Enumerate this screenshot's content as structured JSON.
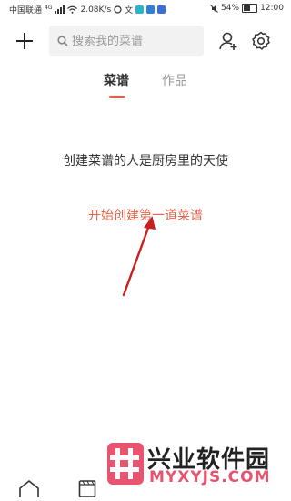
{
  "status_bar": {
    "carrier": "中国联通",
    "network": "4G",
    "speed": "2.08K/s",
    "battery": "54%",
    "battery_level": 0.54,
    "time": "12:00"
  },
  "header": {
    "add_icon": "plus-icon",
    "search": {
      "placeholder": "搜索我的菜谱",
      "value": ""
    },
    "user_icon": "add-user-icon",
    "settings_icon": "gear-icon"
  },
  "tabs": [
    {
      "label": "菜谱",
      "active": true
    },
    {
      "label": "作品",
      "active": false
    }
  ],
  "accent_color": "#e25a4a",
  "main": {
    "empty_message": "创建菜谱的人是厨房里的天使",
    "create_link": "开始创建第一道菜谱"
  },
  "watermark": {
    "title": "兴业软件园",
    "url": "MYXYJS.COM"
  },
  "bottom_nav": {
    "items": [
      {
        "icon": "home-icon"
      },
      {
        "icon": "collection-icon"
      }
    ]
  }
}
